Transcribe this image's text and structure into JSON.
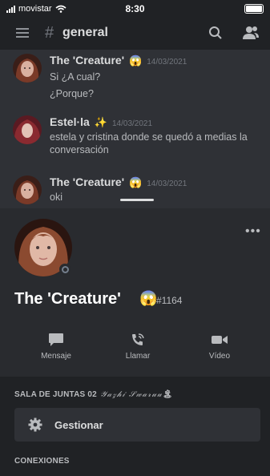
{
  "status_bar": {
    "carrier": "movistar",
    "time": "8:30"
  },
  "header": {
    "channel_name": "general"
  },
  "messages": [
    {
      "author": "The  'Creature'",
      "emoji": "😱",
      "timestamp": "14/03/2021",
      "lines": [
        "Si  ¿A cual?",
        "¿Porque?"
      ]
    },
    {
      "author": "Estel·la",
      "emoji": "✨",
      "timestamp": "14/03/2021",
      "lines": [
        "estela y cristina donde se quedó a medias la",
        "conversación"
      ]
    },
    {
      "author": "The  'Creature'",
      "emoji": "😱",
      "timestamp": "14/03/2021",
      "lines": [
        "oki"
      ]
    }
  ],
  "profile": {
    "name": "The  'Creature'",
    "emoji": "😱",
    "tag": "#1164",
    "more": "•••",
    "actions": [
      {
        "label": "Mensaje",
        "icon": "chat-bubble-icon"
      },
      {
        "label": "Llamar",
        "icon": "phone-call-icon"
      },
      {
        "label": "Vídeo",
        "icon": "video-camera-icon"
      }
    ]
  },
  "voice_section": {
    "title": "SALA DE JUNTAS 02",
    "fancy": "𝒴𝒶𝓏𝒽𝒾 𝒮𝓌𝒶𝓇𝓊𝓊",
    "emoji": "🏝",
    "manage_label": "Gestionar"
  },
  "connections": {
    "title": "CONEXIONES"
  },
  "colors": {
    "background": "#292b2f",
    "chat_bg": "#2f3136",
    "topbar": "#202225",
    "status_ring": "#747f8d"
  }
}
